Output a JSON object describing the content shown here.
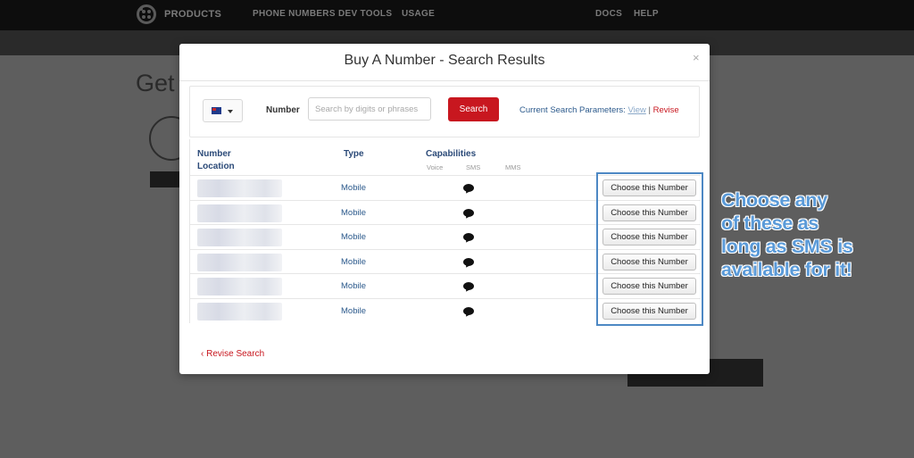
{
  "topnav": {
    "products": "PRODUCTS",
    "phone_numbers": "PHONE NUMBERS",
    "dev_tools": "DEV TOOLS",
    "usage": "USAGE",
    "docs": "DOCS",
    "help": "HELP"
  },
  "background": {
    "page_title": "Get"
  },
  "modal": {
    "title": "Buy A Number - Search Results",
    "close": "×",
    "search": {
      "number_label": "Number",
      "placeholder": "Search by digits or phrases",
      "button": "Search",
      "params_label": "Current Search Parameters:",
      "view_link": "View",
      "separator": "|",
      "revise_link": "Revise"
    },
    "table": {
      "col_number": "Number",
      "col_location": "Location",
      "col_type": "Type",
      "col_capabilities": "Capabilities",
      "cap_voice": "Voice",
      "cap_sms": "SMS",
      "cap_mms": "MMS",
      "rows": [
        {
          "type": "Mobile",
          "sms": true,
          "action": "Choose this Number"
        },
        {
          "type": "Mobile",
          "sms": true,
          "action": "Choose this Number"
        },
        {
          "type": "Mobile",
          "sms": true,
          "action": "Choose this Number"
        },
        {
          "type": "Mobile",
          "sms": true,
          "action": "Choose this Number"
        },
        {
          "type": "Mobile",
          "sms": true,
          "action": "Choose this Number"
        },
        {
          "type": "Mobile",
          "sms": true,
          "action": "Choose this Number"
        }
      ]
    },
    "revise_search": "‹ Revise Search"
  },
  "annotation": {
    "lines": [
      "Choose any",
      "of these as",
      "long as SMS is",
      "available for it!"
    ],
    "color": "#5a9ad8"
  },
  "colors": {
    "brand_red": "#c8171f",
    "highlight_blue": "#4d88c4"
  }
}
